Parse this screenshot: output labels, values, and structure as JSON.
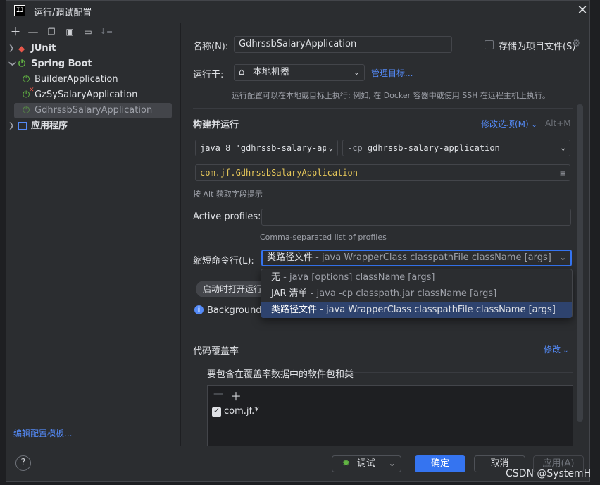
{
  "window": {
    "title": "运行/调试配置",
    "logo": "IJ"
  },
  "sidebar": {
    "toolbar": [
      "plus-icon",
      "minus-icon",
      "copy-icon",
      "save-icon",
      "new-folder-icon",
      "sort-icon"
    ],
    "items": [
      {
        "label": "JUnit",
        "kind": "group"
      },
      {
        "label": "Spring Boot",
        "kind": "group"
      },
      {
        "label": "BuilderApplication"
      },
      {
        "label": "GzSySalaryApplication"
      },
      {
        "label": "GdhrssbSalaryApplication",
        "selected": true
      },
      {
        "label": "应用程序",
        "kind": "group"
      }
    ],
    "edit_templates": "编辑配置模板..."
  },
  "form": {
    "name_label": "名称(N):",
    "name_value": "GdhrssbSalaryApplication",
    "store_as_file_label": "存储为项目文件(S)",
    "run_on_label": "运行于:",
    "run_on_value": "本地机器",
    "manage_targets": "管理目标...",
    "run_on_hint": "运行配置可以在本地或目标上执行: 例如, 在 Docker 容器中或使用 SSH 在远程主机上执行。",
    "build_run_title": "构建并运行",
    "modify_options": "修改选项(M)",
    "modify_shortcut": "Alt+M",
    "jdk_value": "java 8 'gdhrssb-salary-ap",
    "cp_prefix": "-cp",
    "cp_value": "gdhrssb-salary-application",
    "main_class": "com.jf.GdhrssbSalaryApplication",
    "alt_hint": "按 Alt 获取字段提示",
    "active_profiles_label": "Active profiles:",
    "active_profiles_hint": "Comma-separated list of profiles",
    "shorten_label": "缩短命令行(L):",
    "shorten_value_main": "类路径文件",
    "shorten_value_rest": " - java WrapperClass classpathFile className [args]",
    "chip_label": "启动时打开运行",
    "background_label": "Background"
  },
  "popup": {
    "options": [
      {
        "main": "无",
        "rest": " - java [options] className [args]"
      },
      {
        "main": "JAR 清单",
        "rest": " - java -cp classpath.jar className [args]"
      },
      {
        "main": "类路径文件",
        "rest": " - java WrapperClass classpathFile className [args]",
        "selected": true
      }
    ]
  },
  "coverage": {
    "title": "代码覆盖率",
    "modify_link": "修改",
    "include_label": "要包含在覆盖率数据中的软件包和类",
    "entries": [
      {
        "label": "com.jf.*",
        "checked": true
      }
    ]
  },
  "footer": {
    "debug_label": "调试",
    "ok_label": "确定",
    "cancel_label": "取消",
    "apply_label": "应用(A)",
    "help_label": "?"
  },
  "watermark": "CSDN @SystemH",
  "colors": {
    "accent": "#3574f0",
    "link": "#548af7",
    "selection": "#2e436e"
  }
}
